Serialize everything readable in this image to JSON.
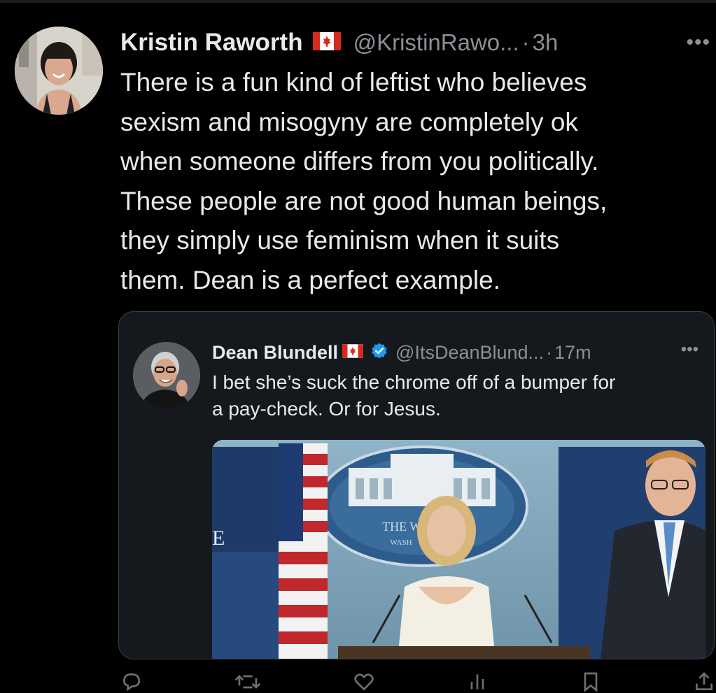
{
  "tweet": {
    "author_name": "Kristin Raworth",
    "author_handle": "@KristinRawo...",
    "separator": "·",
    "time": "3h",
    "more_label": "•••",
    "text": "There is a fun kind of leftist who believes\nsexism and misogyny are completely ok\nwhen someone differs from you politically.\nThese people are not good human beings,\nthey simply use feminism when it suits\nthem. Dean is a perfect example."
  },
  "quote": {
    "author_name": "Dean Blundell",
    "author_handle": "@ItsDeanBlund...",
    "separator": "·",
    "time": "17m",
    "more_label": "•••",
    "verified": true,
    "text": "I bet she’s suck the chrome off of a bumper for\na pay-check. Or for Jesus.",
    "media": {
      "seal_text": "THE WHI      USE",
      "seal_sub": "WASH",
      "backdrop_letter": "E"
    }
  },
  "actions": {
    "icons": [
      "reply-icon",
      "retweet-icon",
      "like-icon",
      "views-icon",
      "bookmark-icon",
      "share-icon"
    ]
  },
  "colors": {
    "background": "#000000",
    "text": "#e7e9ea",
    "muted": "#8b9096",
    "quote_bg": "#15191d",
    "quote_border": "#3a3f44",
    "verified_blue": "#1d9bf0",
    "canada_red": "#d52b1e"
  }
}
